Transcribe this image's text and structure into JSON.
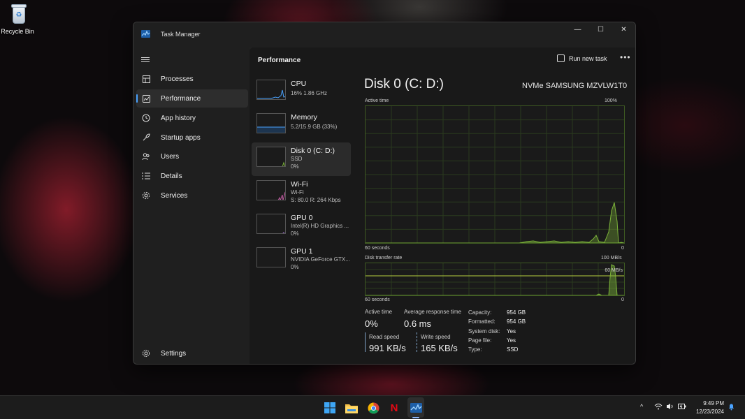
{
  "desktop": {
    "recycle_bin_label": "Recycle Bin"
  },
  "window": {
    "title": "Task Manager",
    "controls": {
      "minimize": "—",
      "maximize": "☐",
      "close": "✕"
    }
  },
  "nav": {
    "items": [
      {
        "label": "Processes",
        "icon": "processes-icon"
      },
      {
        "label": "Performance",
        "icon": "performance-icon"
      },
      {
        "label": "App history",
        "icon": "app-history-icon"
      },
      {
        "label": "Startup apps",
        "icon": "startup-apps-icon"
      },
      {
        "label": "Users",
        "icon": "users-icon"
      },
      {
        "label": "Details",
        "icon": "details-icon"
      },
      {
        "label": "Services",
        "icon": "services-icon"
      }
    ],
    "settings_label": "Settings"
  },
  "main": {
    "title": "Performance",
    "run_new_task": "Run new task",
    "more": "•••"
  },
  "devices": [
    {
      "name": "CPU",
      "line1": "16%  1.86 GHz",
      "line2": ""
    },
    {
      "name": "Memory",
      "line1": "5.2/15.9 GB (33%)",
      "line2": ""
    },
    {
      "name": "Disk 0 (C: D:)",
      "line1": "SSD",
      "line2": "0%"
    },
    {
      "name": "Wi-Fi",
      "line1": "Wi-Fi",
      "line2": "S: 80.0  R: 264 Kbps"
    },
    {
      "name": "GPU 0",
      "line1": "Intel(R) HD Graphics ...",
      "line2": "0%"
    },
    {
      "name": "GPU 1",
      "line1": "NVIDIA GeForce GTX...",
      "line2": "0%"
    }
  ],
  "detail": {
    "title": "Disk 0 (C: D:)",
    "model": "NVMe SAMSUNG MZVLW1T0",
    "active_time_graph": {
      "label": "Active time",
      "max": "100%",
      "x_left": "60 seconds",
      "x_right": "0"
    },
    "transfer_graph": {
      "label": "Disk transfer rate",
      "max": "100 MB/s",
      "mid": "60 MB/s",
      "x_left": "60 seconds",
      "x_right": "0"
    },
    "stats": {
      "active_time_label": "Active time",
      "active_time_value": "0%",
      "avg_response_label": "Average response time",
      "avg_response_value": "0.6 ms",
      "read_label": "Read speed",
      "read_value": "991 KB/s",
      "write_label": "Write speed",
      "write_value": "165 KB/s"
    },
    "properties": [
      {
        "key": "Capacity:",
        "value": "954 GB"
      },
      {
        "key": "Formatted:",
        "value": "954 GB"
      },
      {
        "key": "System disk:",
        "value": "Yes"
      },
      {
        "key": "Page file:",
        "value": "Yes"
      },
      {
        "key": "Type:",
        "value": "SSD"
      }
    ]
  },
  "taskbar": {
    "apps": [
      "windows-start-icon",
      "file-explorer-icon",
      "chrome-icon",
      "netflix-icon",
      "task-manager-icon"
    ],
    "netflix_letter": "N",
    "tray_chevron": "^",
    "time": "9:49 PM",
    "date": "12/23/2024"
  },
  "colors": {
    "accent": "#4aa3ff",
    "disk_graph": "#7db53a"
  }
}
